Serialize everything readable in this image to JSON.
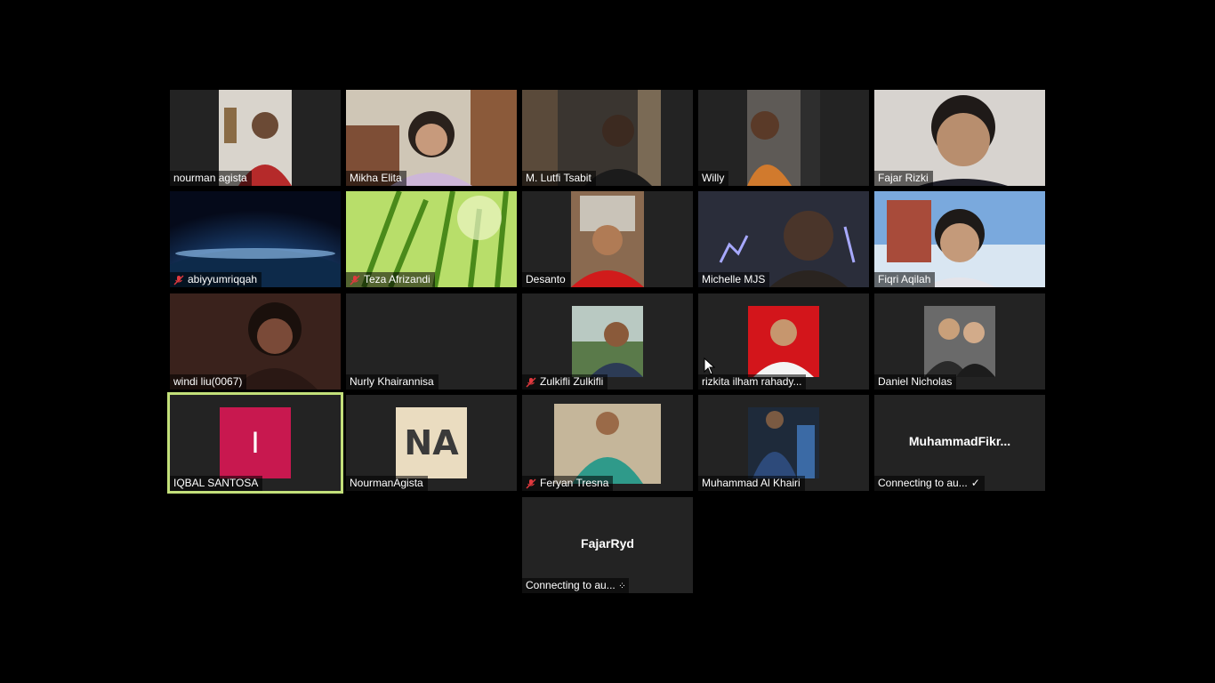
{
  "participants": [
    {
      "name": "nourman agista",
      "muted": false
    },
    {
      "name": "Mikha Elita",
      "muted": false
    },
    {
      "name": "M. Lutfi Tsabit",
      "muted": false
    },
    {
      "name": "Willy",
      "muted": false
    },
    {
      "name": "Fajar Rizki",
      "muted": false
    },
    {
      "name": "abiyyumriqqah",
      "muted": true
    },
    {
      "name": "Teza Afrizandi",
      "muted": true
    },
    {
      "name": "Desanto",
      "muted": false
    },
    {
      "name": "Michelle MJS",
      "muted": false
    },
    {
      "name": "Fiqri Aqilah",
      "muted": false
    },
    {
      "name": "windi liu(0067)",
      "muted": false
    },
    {
      "name": "Nurly Khairannisa",
      "muted": false
    },
    {
      "name": "Zulkifli Zulkifli",
      "muted": true
    },
    {
      "name": "rizkita ilham rahady...",
      "muted": false
    },
    {
      "name": "Daniel Nicholas",
      "muted": false
    },
    {
      "name": "IQBAL SANTOSA",
      "muted": false,
      "active_speaker": true,
      "avatar_letter": "I",
      "avatar_color": "#c8184f"
    },
    {
      "name": "NourmanAgista",
      "muted": false,
      "avatar_text": "NA"
    },
    {
      "name": "Feryan Tresna",
      "muted": true
    },
    {
      "name": "Muhammad Al Khairi",
      "muted": false
    },
    {
      "name": "Connecting to au...",
      "muted": false,
      "display_name": "MuhammadFikr...",
      "status_icon": "check-icon"
    },
    {
      "name": "Connecting to au...",
      "muted": false,
      "display_name": "FajarRyd",
      "status_icon": "loading-dots-icon"
    }
  ],
  "colors": {
    "tile_bg": "#232323",
    "active_border": "#c3e07a",
    "mic_off": "#e0393e"
  }
}
